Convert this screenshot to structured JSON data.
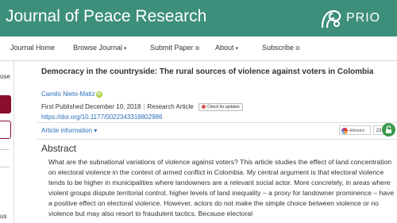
{
  "header": {
    "journal_title": "Journal of Peace Research",
    "logo_text": "PRIO"
  },
  "nav": {
    "items": [
      {
        "label": "Journal Home"
      },
      {
        "label": "Browse Journal"
      },
      {
        "label": "Submit Paper"
      },
      {
        "label": "About"
      },
      {
        "label": "Subscribe"
      }
    ]
  },
  "sidebar": {
    "close_label": "ose",
    "bottom_text": "us"
  },
  "article": {
    "title": "Democracy in the countryside: The rural sources of violence against voters in Colombia",
    "author": "Camilo Nieto-Matiz",
    "first_published": "First Published December 10, 2018",
    "type": "Research Article",
    "updates_label": "Check for updates",
    "doi": "https://doi.org/10.1177/0022343318802986",
    "info_label": "Article information",
    "altmetric_label": "Altmetric",
    "altmetric_count": "23"
  },
  "abstract": {
    "heading": "Abstract",
    "text": "What are the subnational variations of violence against voters? This article studies the effect of land concentration on electoral violence in the context of armed conflict in Colombia. My central argument is that electoral violence tends to be higher in municipalities where landowners are a relevant social actor. More concretely, in areas where violent groups dispute territorial control, higher levels of land inequality – a proxy for landowner prominence – have a positive effect on electoral violence. However, actors do not make the simple choice between violence or no violence but may also resort to fraudulent tactics. Because electoral"
  },
  "colors": {
    "header_bg": "#3d8f7b",
    "link": "#2a6ebb",
    "accent_red": "#8b0e2c",
    "lock_green": "#3a9a4c"
  }
}
